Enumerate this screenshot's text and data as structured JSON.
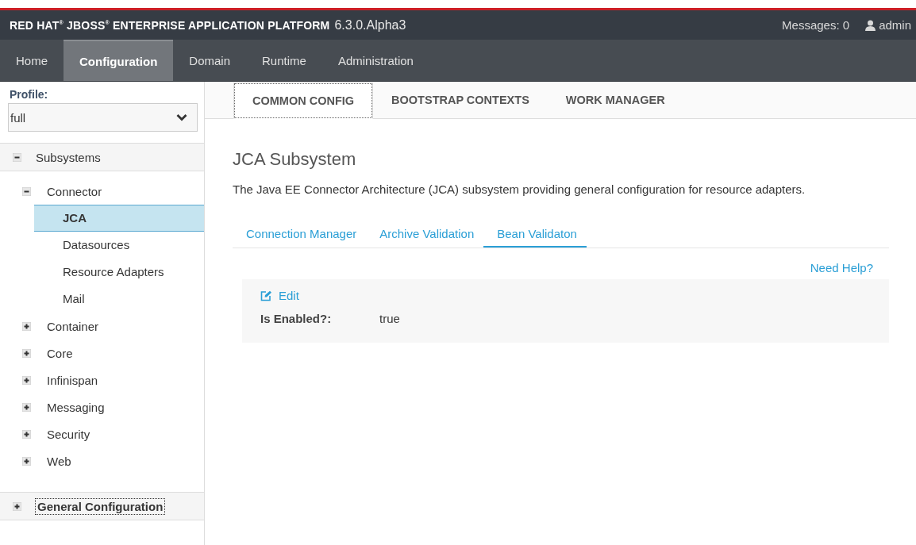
{
  "header": {
    "brand": "RED HAT$^{®}$ JBOSS$^{®}$ ENTERPRISE APPLICATION PLATFORM",
    "version": "6.3.0.Alpha3",
    "messages": "Messages: 0",
    "user": "admin"
  },
  "nav": [
    {
      "label": "Home",
      "selected": false
    },
    {
      "label": "Configuration",
      "selected": true
    },
    {
      "label": "Domain",
      "selected": false
    },
    {
      "label": "Runtime",
      "selected": false
    },
    {
      "label": "Administration",
      "selected": false
    }
  ],
  "sidebar": {
    "profile_label": "Profile:",
    "profile": "full",
    "groups": [
      {
        "label": "Subsystems",
        "expanded": true,
        "children": [
          {
            "label": "Connector",
            "expanded": true,
            "children": [
              {
                "label": "JCA",
                "selected": true
              },
              {
                "label": "Datasources",
                "selected": false
              },
              {
                "label": "Resource Adapters",
                "selected": false
              },
              {
                "label": "Mail",
                "selected": false
              }
            ]
          },
          {
            "label": "Container",
            "expanded": false
          },
          {
            "label": "Core",
            "expanded": false
          },
          {
            "label": "Infinispan",
            "expanded": false
          },
          {
            "label": "Messaging",
            "expanded": false
          },
          {
            "label": "Security",
            "expanded": false
          },
          {
            "label": "Web",
            "expanded": false
          }
        ]
      },
      {
        "label": "General Configuration",
        "expanded": false,
        "focused": true
      }
    ]
  },
  "tabs": [
    {
      "label": "COMMON CONFIG",
      "selected": true
    },
    {
      "label": "BOOTSTRAP CONTEXTS",
      "selected": false
    },
    {
      "label": "WORK MANAGER",
      "selected": false
    }
  ],
  "title": "JCA Subsystem",
  "description": "The Java EE Connector Architecture (JCA) subsystem providing general configuration for resource adapters.",
  "subtabs": [
    {
      "label": "Connection Manager",
      "selected": false
    },
    {
      "label": "Archive Validation",
      "selected": false
    },
    {
      "label": "Bean Validaton",
      "selected": true
    }
  ],
  "help": "Need Help?",
  "edit": "Edit",
  "fields": [
    {
      "label": "Is Enabled?:",
      "value": "true"
    }
  ]
}
